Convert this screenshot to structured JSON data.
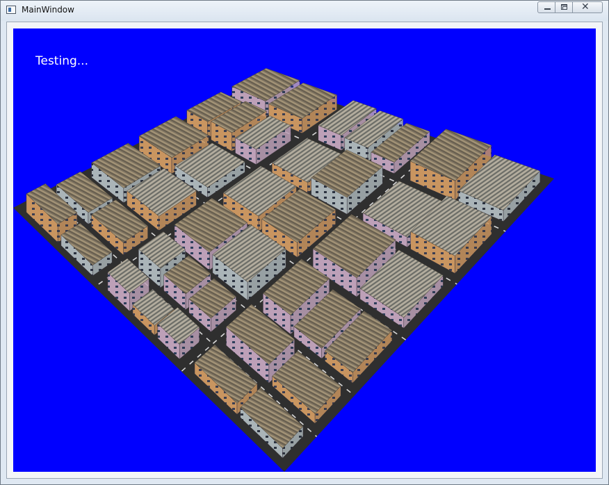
{
  "window": {
    "title": "MainWindow",
    "controls": {
      "minimize": "minimize",
      "maximize": "maximize",
      "close": "close"
    }
  },
  "scene": {
    "overlay_text": "Testing...",
    "background_color": "#0000ff",
    "road_color": "#2f2f2f",
    "building_roof_color": "#7f7462",
    "building_wall_colors": [
      "#b8a2b4",
      "#c79a62",
      "#a9b3b8"
    ]
  }
}
